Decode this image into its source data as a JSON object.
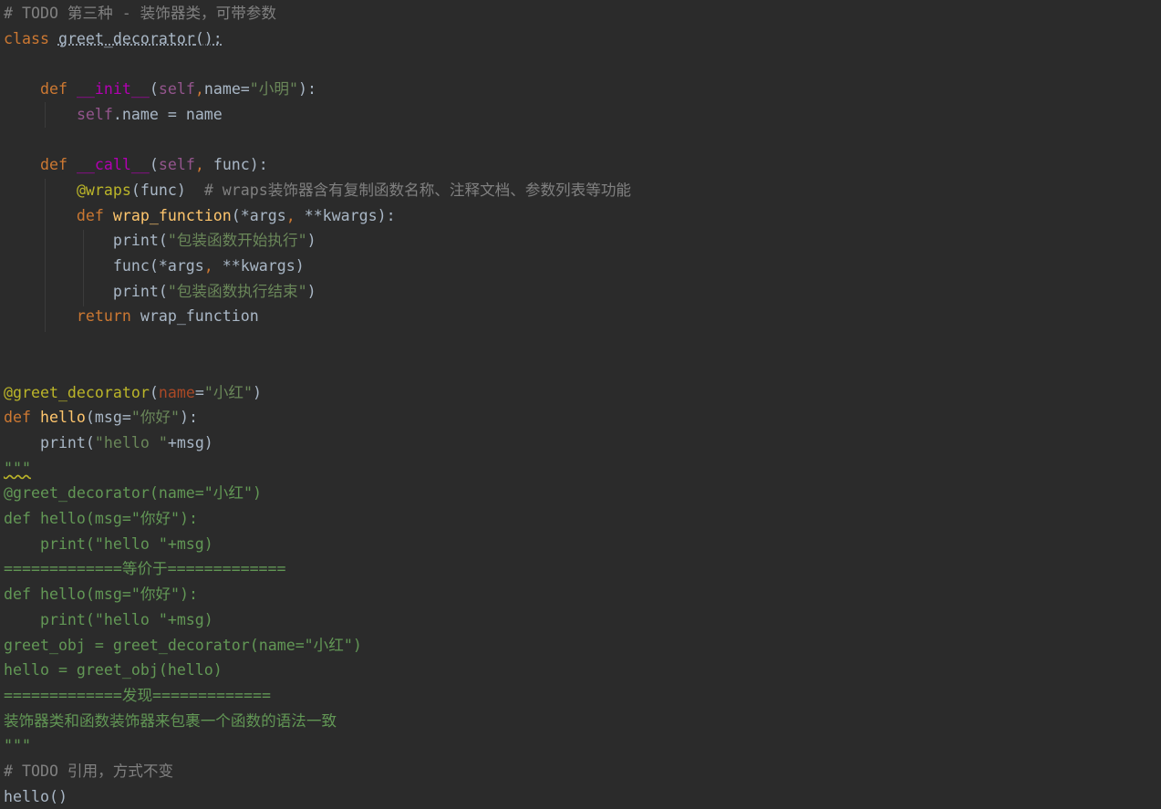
{
  "editor": {
    "language": "python",
    "theme_colors": {
      "background": "#2b2b2b",
      "keyword": "#cc7832",
      "function_name": "#ffc66d",
      "self": "#94558d",
      "string": "#6a8759",
      "decorator": "#bbb529",
      "param": "#aa4926",
      "comment": "#808080",
      "docstring": "#629755",
      "plain": "#a9b7c6"
    },
    "lines": [
      [
        {
          "t": "# TODO 第三种 - 装饰器类，可带参数",
          "c": "comment"
        }
      ],
      [
        {
          "t": "class ",
          "c": "kw"
        },
        {
          "t": "greet_decorator",
          "c": "plain link"
        },
        {
          "t": "():",
          "c": "plain link"
        }
      ],
      [],
      [
        {
          "t": "    def ",
          "c": "kw"
        },
        {
          "t": "__init__",
          "c": "magic"
        },
        {
          "t": "(",
          "c": "plain"
        },
        {
          "t": "self",
          "c": "self"
        },
        {
          "t": ",",
          "c": "kw"
        },
        {
          "t": "name=",
          "c": "plain"
        },
        {
          "t": "\"小明\"",
          "c": "str"
        },
        {
          "t": "):",
          "c": "plain"
        }
      ],
      [
        {
          "t": "        ",
          "c": "plain"
        },
        {
          "t": "self",
          "c": "self"
        },
        {
          "t": ".name = name",
          "c": "plain"
        }
      ],
      [],
      [
        {
          "t": "    def ",
          "c": "kw"
        },
        {
          "t": "__call__",
          "c": "magic"
        },
        {
          "t": "(",
          "c": "plain"
        },
        {
          "t": "self",
          "c": "self"
        },
        {
          "t": ", ",
          "c": "kw"
        },
        {
          "t": "func):",
          "c": "plain"
        }
      ],
      [
        {
          "t": "        ",
          "c": "plain"
        },
        {
          "t": "@wraps",
          "c": "dec"
        },
        {
          "t": "(func)  ",
          "c": "plain"
        },
        {
          "t": "# wraps装饰器含有复制函数名称、注释文档、参数列表等功能",
          "c": "comment"
        }
      ],
      [
        {
          "t": "        def ",
          "c": "kw"
        },
        {
          "t": "wrap_function",
          "c": "fn"
        },
        {
          "t": "(*args",
          "c": "plain"
        },
        {
          "t": ", ",
          "c": "kw"
        },
        {
          "t": "**kwargs):",
          "c": "plain"
        }
      ],
      [
        {
          "t": "            print(",
          "c": "plain"
        },
        {
          "t": "\"包装函数开始执行\"",
          "c": "str"
        },
        {
          "t": ")",
          "c": "plain"
        }
      ],
      [
        {
          "t": "            func(*args",
          "c": "plain"
        },
        {
          "t": ", ",
          "c": "kw"
        },
        {
          "t": "**kwargs)",
          "c": "plain"
        }
      ],
      [
        {
          "t": "            print(",
          "c": "plain"
        },
        {
          "t": "\"包装函数执行结束\"",
          "c": "str"
        },
        {
          "t": ")",
          "c": "plain"
        }
      ],
      [
        {
          "t": "        return ",
          "c": "kw"
        },
        {
          "t": "wrap_function",
          "c": "plain"
        }
      ],
      [],
      [],
      [
        {
          "t": "@greet_decorator",
          "c": "dec"
        },
        {
          "t": "(",
          "c": "plain"
        },
        {
          "t": "name",
          "c": "param"
        },
        {
          "t": "=",
          "c": "plain"
        },
        {
          "t": "\"小红\"",
          "c": "str"
        },
        {
          "t": ")",
          "c": "plain"
        }
      ],
      [
        {
          "t": "def ",
          "c": "kw"
        },
        {
          "t": "hello",
          "c": "fn"
        },
        {
          "t": "(msg=",
          "c": "plain"
        },
        {
          "t": "\"你好\"",
          "c": "str"
        },
        {
          "t": "):",
          "c": "plain"
        }
      ],
      [
        {
          "t": "    print(",
          "c": "plain"
        },
        {
          "t": "\"hello \"",
          "c": "str"
        },
        {
          "t": "+msg)",
          "c": "plain"
        }
      ],
      [
        {
          "t": "\"\"\"",
          "c": "doc wavy"
        }
      ],
      [
        {
          "t": "@greet_decorator(name=\"小红\")",
          "c": "doc"
        }
      ],
      [
        {
          "t": "def hello(msg=\"你好\"):",
          "c": "doc"
        }
      ],
      [
        {
          "t": "    print(\"hello \"+msg)",
          "c": "doc"
        }
      ],
      [
        {
          "t": "=============等价于=============",
          "c": "doc"
        }
      ],
      [
        {
          "t": "def hello(msg=\"你好\"):",
          "c": "doc"
        }
      ],
      [
        {
          "t": "    print(\"hello \"+msg)",
          "c": "doc"
        }
      ],
      [
        {
          "t": "greet_obj = greet_decorator(name=\"小红\")",
          "c": "doc"
        }
      ],
      [
        {
          "t": "hello = greet_obj(hello)",
          "c": "doc"
        }
      ],
      [
        {
          "t": "=============发现=============",
          "c": "doc"
        }
      ],
      [
        {
          "t": "装饰器类和函数装饰器来包裹一个函数的语法一致",
          "c": "doc"
        }
      ],
      [
        {
          "t": "\"\"\"",
          "c": "doc"
        }
      ],
      [
        {
          "t": "# TODO 引用，方式不变",
          "c": "comment"
        }
      ],
      [
        {
          "t": "hello()",
          "c": "plain"
        }
      ]
    ]
  }
}
